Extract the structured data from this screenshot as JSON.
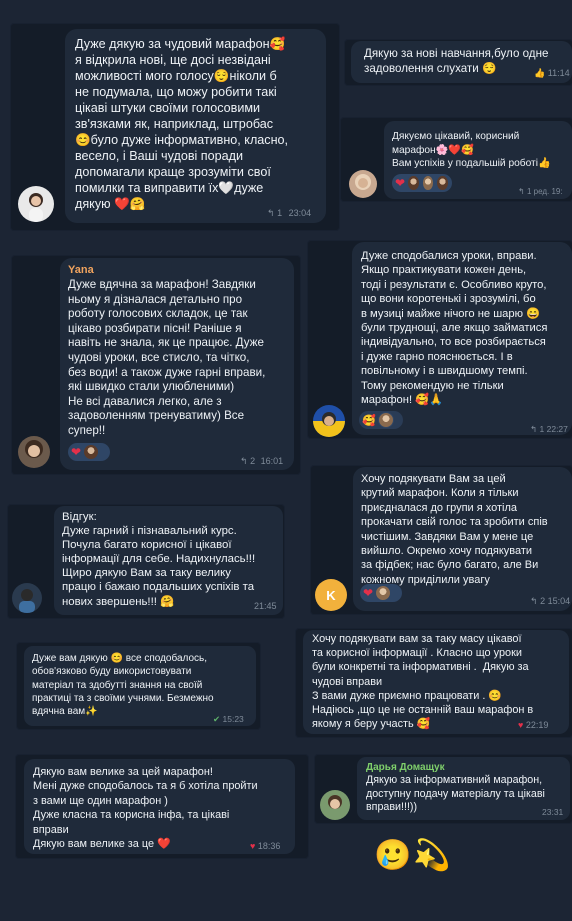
{
  "messages": [
    {
      "text": "Дуже дякую за чудовий марафон🥰\nя відкрила нові, ще досі незвідані\nможливості мого голосу😌ніколи б\nне подумала, що можу робити такі\nцікаві штуки своїми голосовими\nзв'язками як, наприклад, штробас\n😊було дуже інформативно, класно,\nвесело, і Ваші чудові поради\nдопомагали краще зрозуміти свої\nпомилки та виправити їх🤍дуже\nдякую ❤️🤗",
      "replies": "1",
      "time": "23:04"
    },
    {
      "text": "Дякую за нові навчання,було одне\nзадоволення слухати 😌",
      "time": "11:14"
    },
    {
      "text": "Дякуємо цікавий, корисний\nмарафон🌸❤️🥰\nВам успіхів у подальшій роботі👍",
      "replies": "1",
      "edited": "ред.",
      "time": "19:"
    },
    {
      "author": "Yana",
      "text": "Дуже вдячна за марафон! Завдяки\nньому я дізналася детально про\nроботу голосових складок, це так\nцікаво розбирати пісні! Раніше я\nнавіть не знала, як це працює. Дуже\nчудові уроки, все стисло, та чітко,\nбез води! а також дуже гарні вправи,\nякі швидко стали улюбленими)\nНе всі давалися легко, але з\nзадоволенням тренуватиму) Все\nсупер!!",
      "replies": "2",
      "time": "16:01"
    },
    {
      "text": "Дуже сподобалися уроки, вправи.\nЯкщо практикувати кожен день,\nтоді і результати є. Особливо круто,\nщо вони коротенькі і зрозумілі, бо\nв музиці майже нічого не шарю 😄\nбули труднощі, але якщо займатися\nіндивідуально, то все розбирається\nі дуже гарно пояснюється. І в\nповільному і в швидшому темпі.\nТому рекомендую не тільки\nмарафон! 🥰🙏",
      "replies": "1",
      "time": "22:27"
    },
    {
      "text": "Відгук:\nДуже гарний і пізнавальний курс.\nПочула багато корисної і цікавої\nінформації для себе. Надихнулась!!!\nЩиро дякую Вам за таку велику\nпрацю і бажаю подальших успіхів та\nнових звершень!!! 🤗",
      "time": "21:45"
    },
    {
      "text": "Хочу подякувати Вам за цей\nкрутий марафон. Коли я тільки\nприєдналася до групи я хотіла\nпрокачати свій голос та зробити спів\nчистішим. Завдяки Вам у мене це\nвийшло. Окремо хочу подякувати\nза фідбек; нас було багато, але Ви\nкожному приділили увагу",
      "avatar_letter": "K",
      "replies": "2",
      "time": "15:04"
    },
    {
      "text": "Дуже вам дякую 😊 все сподобалось,\nобов'язково буду використовувати\nматеріал та здобутті знання на своїй\nпрактиці та з своїми учнями. Безмежно\nвдячна вам✨",
      "time": "15:23"
    },
    {
      "text": "Хочу подякувати вам за таку масу цікавої\nта корисної інформації . Класно що уроки\nбули конкретні та інформативні .  Дякую за\nчудові вправи\nЗ вами дуже приємно працювати . 😊\nНадіюсь ,що це не останній ваш марафон в\nякому я беру участь 🥰",
      "time": "22:19"
    },
    {
      "text": "Дякую вам велике за цей марафон!\nМені дуже сподобалось та я б хотіла пройти\nз вами ще один марафон )\nДуже класна та корисна інфа, та цікаві\nвправи\nДякую вам велике за це ❤️",
      "time": "18:36"
    },
    {
      "author": "Дарья Домащук",
      "text": "Дякую за інформативний марафон,\nдоступну подачу матеріалу та цікаві\nвправи!!!))",
      "time": "23:31"
    }
  ],
  "footer_emoji": "🥲💫",
  "colors": {
    "background": "#1c2534",
    "card": "#141c28",
    "bubble": "#1f2a3a",
    "author_yana": "#f0a35e",
    "author_darya": "#7fcf6b",
    "reaction_bg": "#2f4666",
    "heart": "#e2304a"
  }
}
